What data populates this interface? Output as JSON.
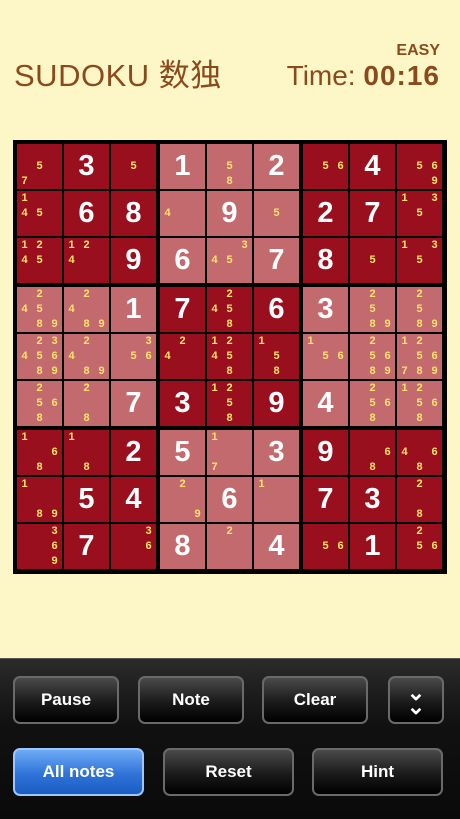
{
  "header": {
    "title": "SUDOKU 数独",
    "difficulty": "EASY",
    "time_label": "Time:",
    "time_value": "00:16"
  },
  "toolbar": {
    "pause": "Pause",
    "note": "Note",
    "clear": "Clear",
    "all_notes": "All notes",
    "reset": "Reset",
    "hint": "Hint",
    "expand_icon": "double-chevron-down-icon"
  },
  "colors": {
    "dark_cell": "#9a0f1e",
    "light_cell": "#c26a6e",
    "note": "#ffe36a",
    "background": "#fdf7c8",
    "title": "#8b4a1c"
  },
  "board": [
    [
      {
        "n": [
          7,
          5
        ]
      },
      {
        "v": 3
      },
      {
        "n": [
          5
        ]
      },
      {
        "v": 1
      },
      {
        "n": [
          5,
          8
        ]
      },
      {
        "v": 2
      },
      {
        "n": [
          5,
          6
        ]
      },
      {
        "v": 4
      },
      {
        "n": [
          5,
          6,
          9
        ]
      }
    ],
    [
      {
        "n": [
          1,
          4,
          5
        ]
      },
      {
        "v": 6
      },
      {
        "v": 8
      },
      {
        "n": [
          4
        ]
      },
      {
        "v": 9
      },
      {
        "n": [
          5
        ]
      },
      {
        "v": 2
      },
      {
        "v": 7
      },
      {
        "n": [
          1,
          3,
          5
        ]
      }
    ],
    [
      {
        "n": [
          1,
          2,
          4,
          5
        ]
      },
      {
        "n": [
          1,
          2,
          4
        ]
      },
      {
        "v": 9
      },
      {
        "v": 6
      },
      {
        "n": [
          3,
          4,
          5
        ]
      },
      {
        "v": 7
      },
      {
        "v": 8
      },
      {
        "n": [
          5
        ]
      },
      {
        "n": [
          1,
          3,
          5
        ]
      }
    ],
    [
      {
        "n": [
          2,
          4,
          5,
          8,
          9
        ]
      },
      {
        "n": [
          2,
          4,
          8,
          9
        ]
      },
      {
        "v": 1
      },
      {
        "v": 7
      },
      {
        "n": [
          2,
          4,
          5,
          8
        ]
      },
      {
        "v": 6
      },
      {
        "v": 3
      },
      {
        "n": [
          2,
          5,
          8,
          9
        ]
      },
      {
        "n": [
          2,
          5,
          8,
          9
        ]
      }
    ],
    [
      {
        "n": [
          2,
          3,
          4,
          5,
          6,
          8,
          9
        ]
      },
      {
        "n": [
          2,
          4,
          8,
          9
        ]
      },
      {
        "n": [
          3,
          5,
          6
        ]
      },
      {
        "n": [
          2,
          4
        ]
      },
      {
        "n": [
          1,
          2,
          4,
          5,
          8
        ]
      },
      {
        "n": [
          1,
          5,
          8
        ]
      },
      {
        "n": [
          1,
          5,
          6
        ]
      },
      {
        "n": [
          2,
          5,
          6,
          8,
          9
        ]
      },
      {
        "n": [
          1,
          2,
          5,
          6,
          7,
          8,
          9
        ]
      }
    ],
    [
      {
        "n": [
          2,
          5,
          6,
          8
        ]
      },
      {
        "n": [
          2,
          8
        ]
      },
      {
        "v": 7
      },
      {
        "v": 3
      },
      {
        "n": [
          1,
          2,
          5,
          8
        ]
      },
      {
        "v": 9
      },
      {
        "v": 4
      },
      {
        "n": [
          2,
          5,
          6,
          8
        ]
      },
      {
        "n": [
          1,
          2,
          5,
          6,
          8
        ]
      }
    ],
    [
      {
        "n": [
          1,
          6,
          8
        ]
      },
      {
        "n": [
          1,
          8
        ]
      },
      {
        "v": 2
      },
      {
        "v": 5
      },
      {
        "n": [
          1,
          7
        ]
      },
      {
        "v": 3
      },
      {
        "v": 9
      },
      {
        "n": [
          6,
          8
        ]
      },
      {
        "n": [
          4,
          6,
          8
        ]
      }
    ],
    [
      {
        "n": [
          1,
          8,
          9
        ]
      },
      {
        "v": 5
      },
      {
        "v": 4
      },
      {
        "n": [
          2,
          9
        ]
      },
      {
        "v": 6
      },
      {
        "n": [
          1
        ]
      },
      {
        "v": 7
      },
      {
        "v": 3
      },
      {
        "n": [
          2,
          8
        ]
      }
    ],
    [
      {
        "n": [
          3,
          6,
          9
        ]
      },
      {
        "v": 7
      },
      {
        "n": [
          3,
          6
        ]
      },
      {
        "v": 8
      },
      {
        "n": [
          2
        ]
      },
      {
        "v": 4
      },
      {
        "n": [
          5,
          6
        ]
      },
      {
        "v": 1
      },
      {
        "n": [
          2,
          5,
          6
        ]
      }
    ]
  ]
}
